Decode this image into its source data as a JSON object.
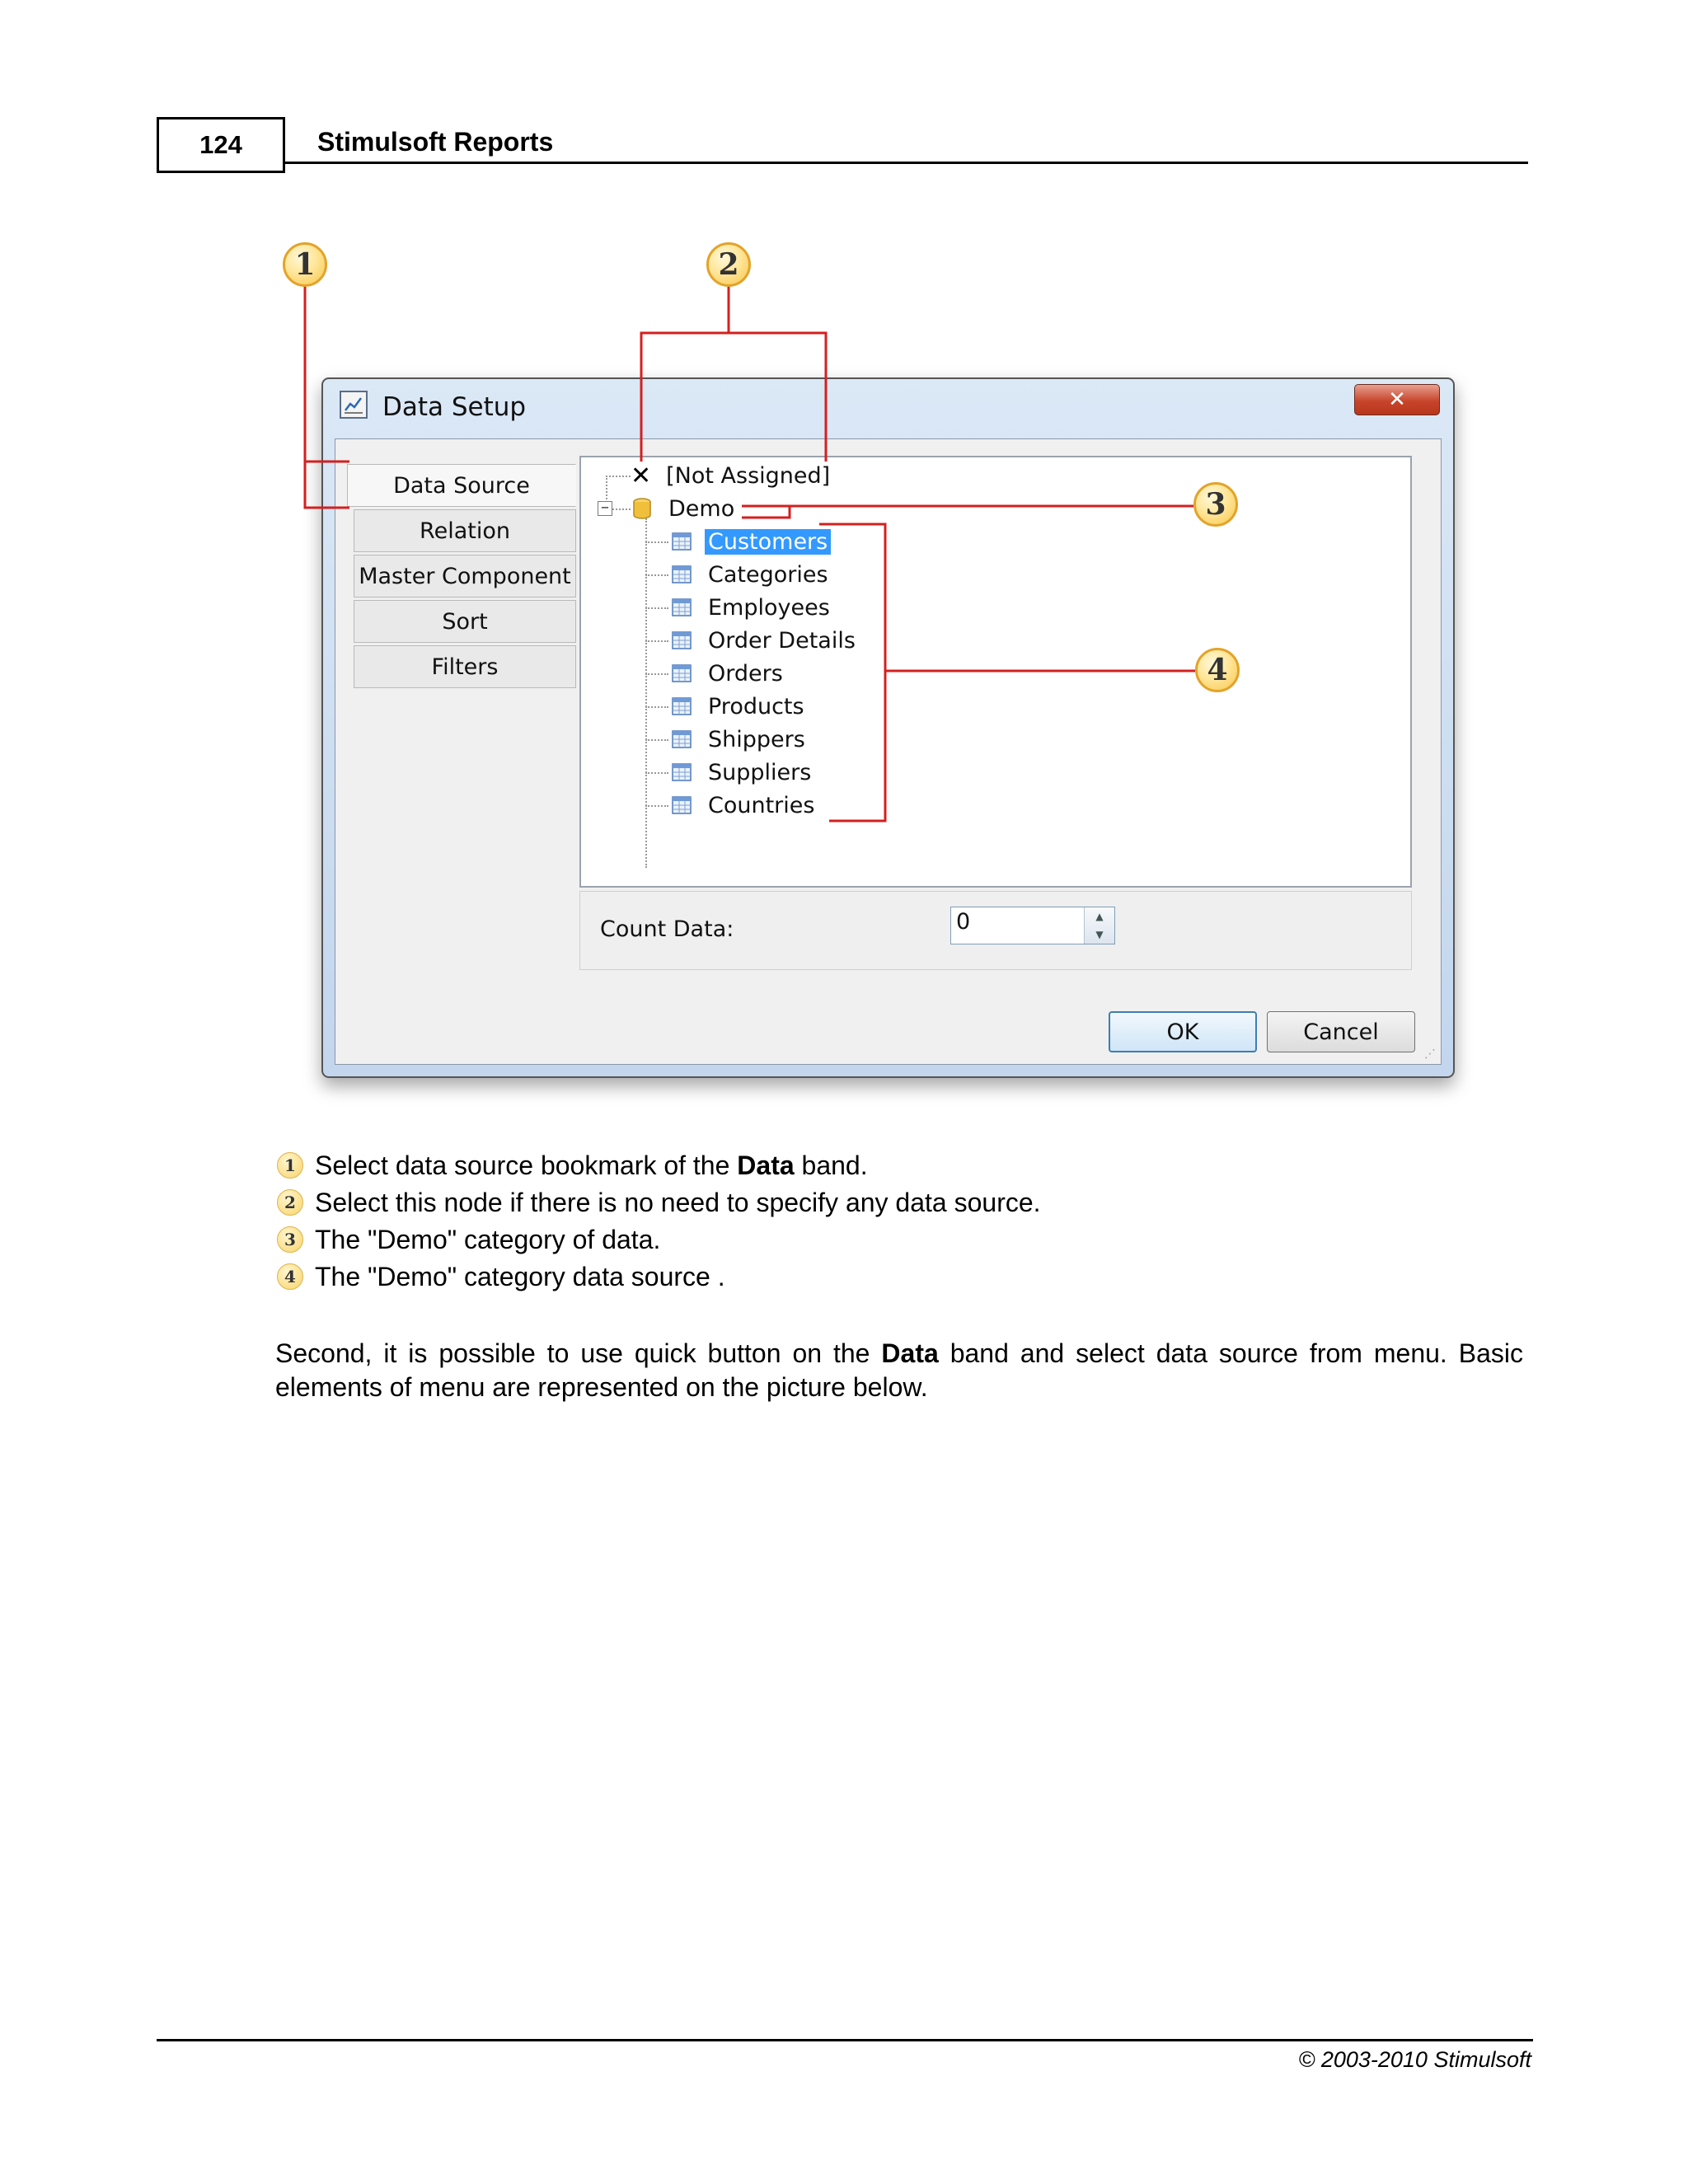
{
  "header": {
    "page_number": "124",
    "title": "Stimulsoft Reports"
  },
  "callouts": [
    "1",
    "2",
    "3",
    "4"
  ],
  "dialog": {
    "title": "Data Setup",
    "close_glyph": "✕",
    "tabs": [
      "Data Source",
      "Relation",
      "Master Component",
      "Sort",
      "Filters"
    ],
    "active_tab": "Data Source",
    "tree": {
      "not_assigned": "[Not Assigned]",
      "category": "Demo",
      "category_expander": "−",
      "items": [
        "Customers",
        "Categories",
        "Employees",
        "Order Details",
        "Orders",
        "Products",
        "Shippers",
        "Suppliers",
        "Countries"
      ],
      "selected": "Customers"
    },
    "count_label": "Count Data:",
    "count_value": "0",
    "spin_up": "▲",
    "spin_down": "▼",
    "ok_label": "OK",
    "cancel_label": "Cancel",
    "grip": "⋰"
  },
  "legend": [
    {
      "num": "1",
      "pre": "Select data source bookmark of the ",
      "bold": "Data",
      "post": " band."
    },
    {
      "num": "2",
      "pre": "Select this node if there is no need to specify any data source.",
      "bold": "",
      "post": ""
    },
    {
      "num": "3",
      "pre": "The \"Demo\" category of data.",
      "bold": "",
      "post": ""
    },
    {
      "num": "4",
      "pre": "The \"Demo\" category data source .",
      "bold": "",
      "post": ""
    }
  ],
  "paragraph": {
    "pre": "Second, it is possible to use quick button on the ",
    "bold": "Data",
    "post_line1": " band and select data source from menu. Basic",
    "line2": "elements of menu are represented on the picture below."
  },
  "footer": {
    "copyright": "© 2003-2010 Stimulsoft"
  },
  "colors": {
    "callout_line": "#d42020",
    "selection": "#3399ff"
  }
}
